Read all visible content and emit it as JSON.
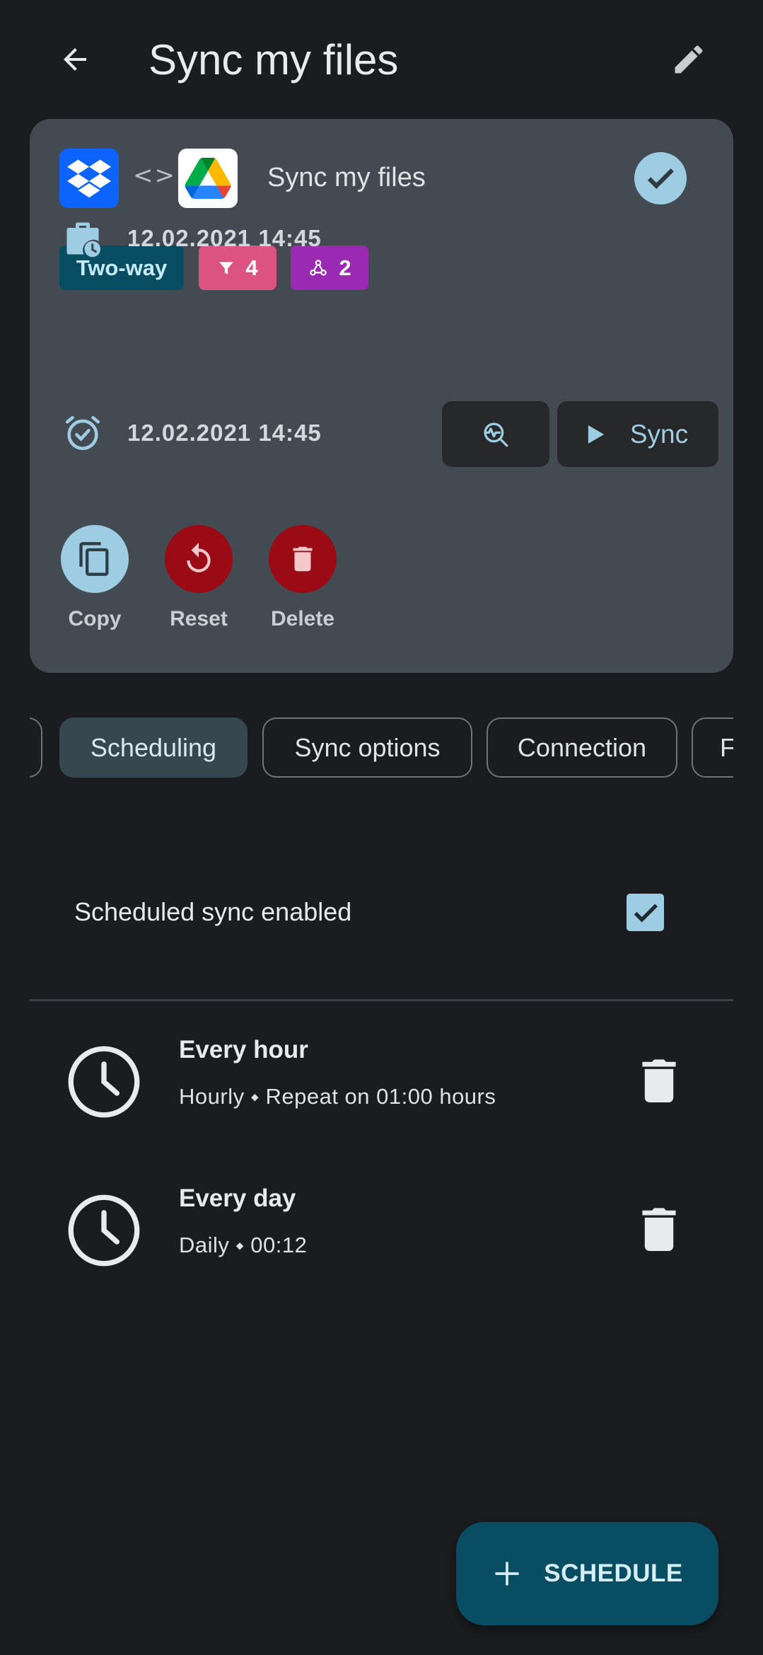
{
  "appbar": {
    "title": "Sync my files"
  },
  "card": {
    "title": "Sync my files",
    "direction_symbol": "<>",
    "source_app_icon": "dropbox-icon",
    "target_app_icon": "google-drive-icon",
    "chips": {
      "mode": "Two-way",
      "filter_count": "4",
      "webhook_count": "2"
    },
    "last_sync": "12.02.2021 14:45",
    "next_sync": "12.02.2021 14:45",
    "sync_button": "Sync",
    "actions": {
      "copy": "Copy",
      "reset": "Reset",
      "delete": "Delete"
    }
  },
  "tabs": {
    "items": [
      "Scheduling",
      "Sync options",
      "Connection",
      "F"
    ],
    "active": "Scheduling"
  },
  "scheduling": {
    "enabled_label": "Scheduled sync enabled",
    "enabled": true,
    "items": [
      {
        "title": "Every hour",
        "subtitle": "Hourly ⬩ Repeat on 01:00 hours"
      },
      {
        "title": "Every day",
        "subtitle": "Daily ⬩ 00:12"
      }
    ]
  },
  "fab": {
    "label": "SCHEDULE"
  },
  "colors": {
    "background": "#1a1c1f",
    "card": "#434a51",
    "accent": "#9ecde3",
    "danger": "#9a0b16",
    "fab": "#084d62",
    "chip_twoway": "#094d63",
    "chip_filter": "#dc5280",
    "chip_webhook": "#9b2ab3"
  }
}
